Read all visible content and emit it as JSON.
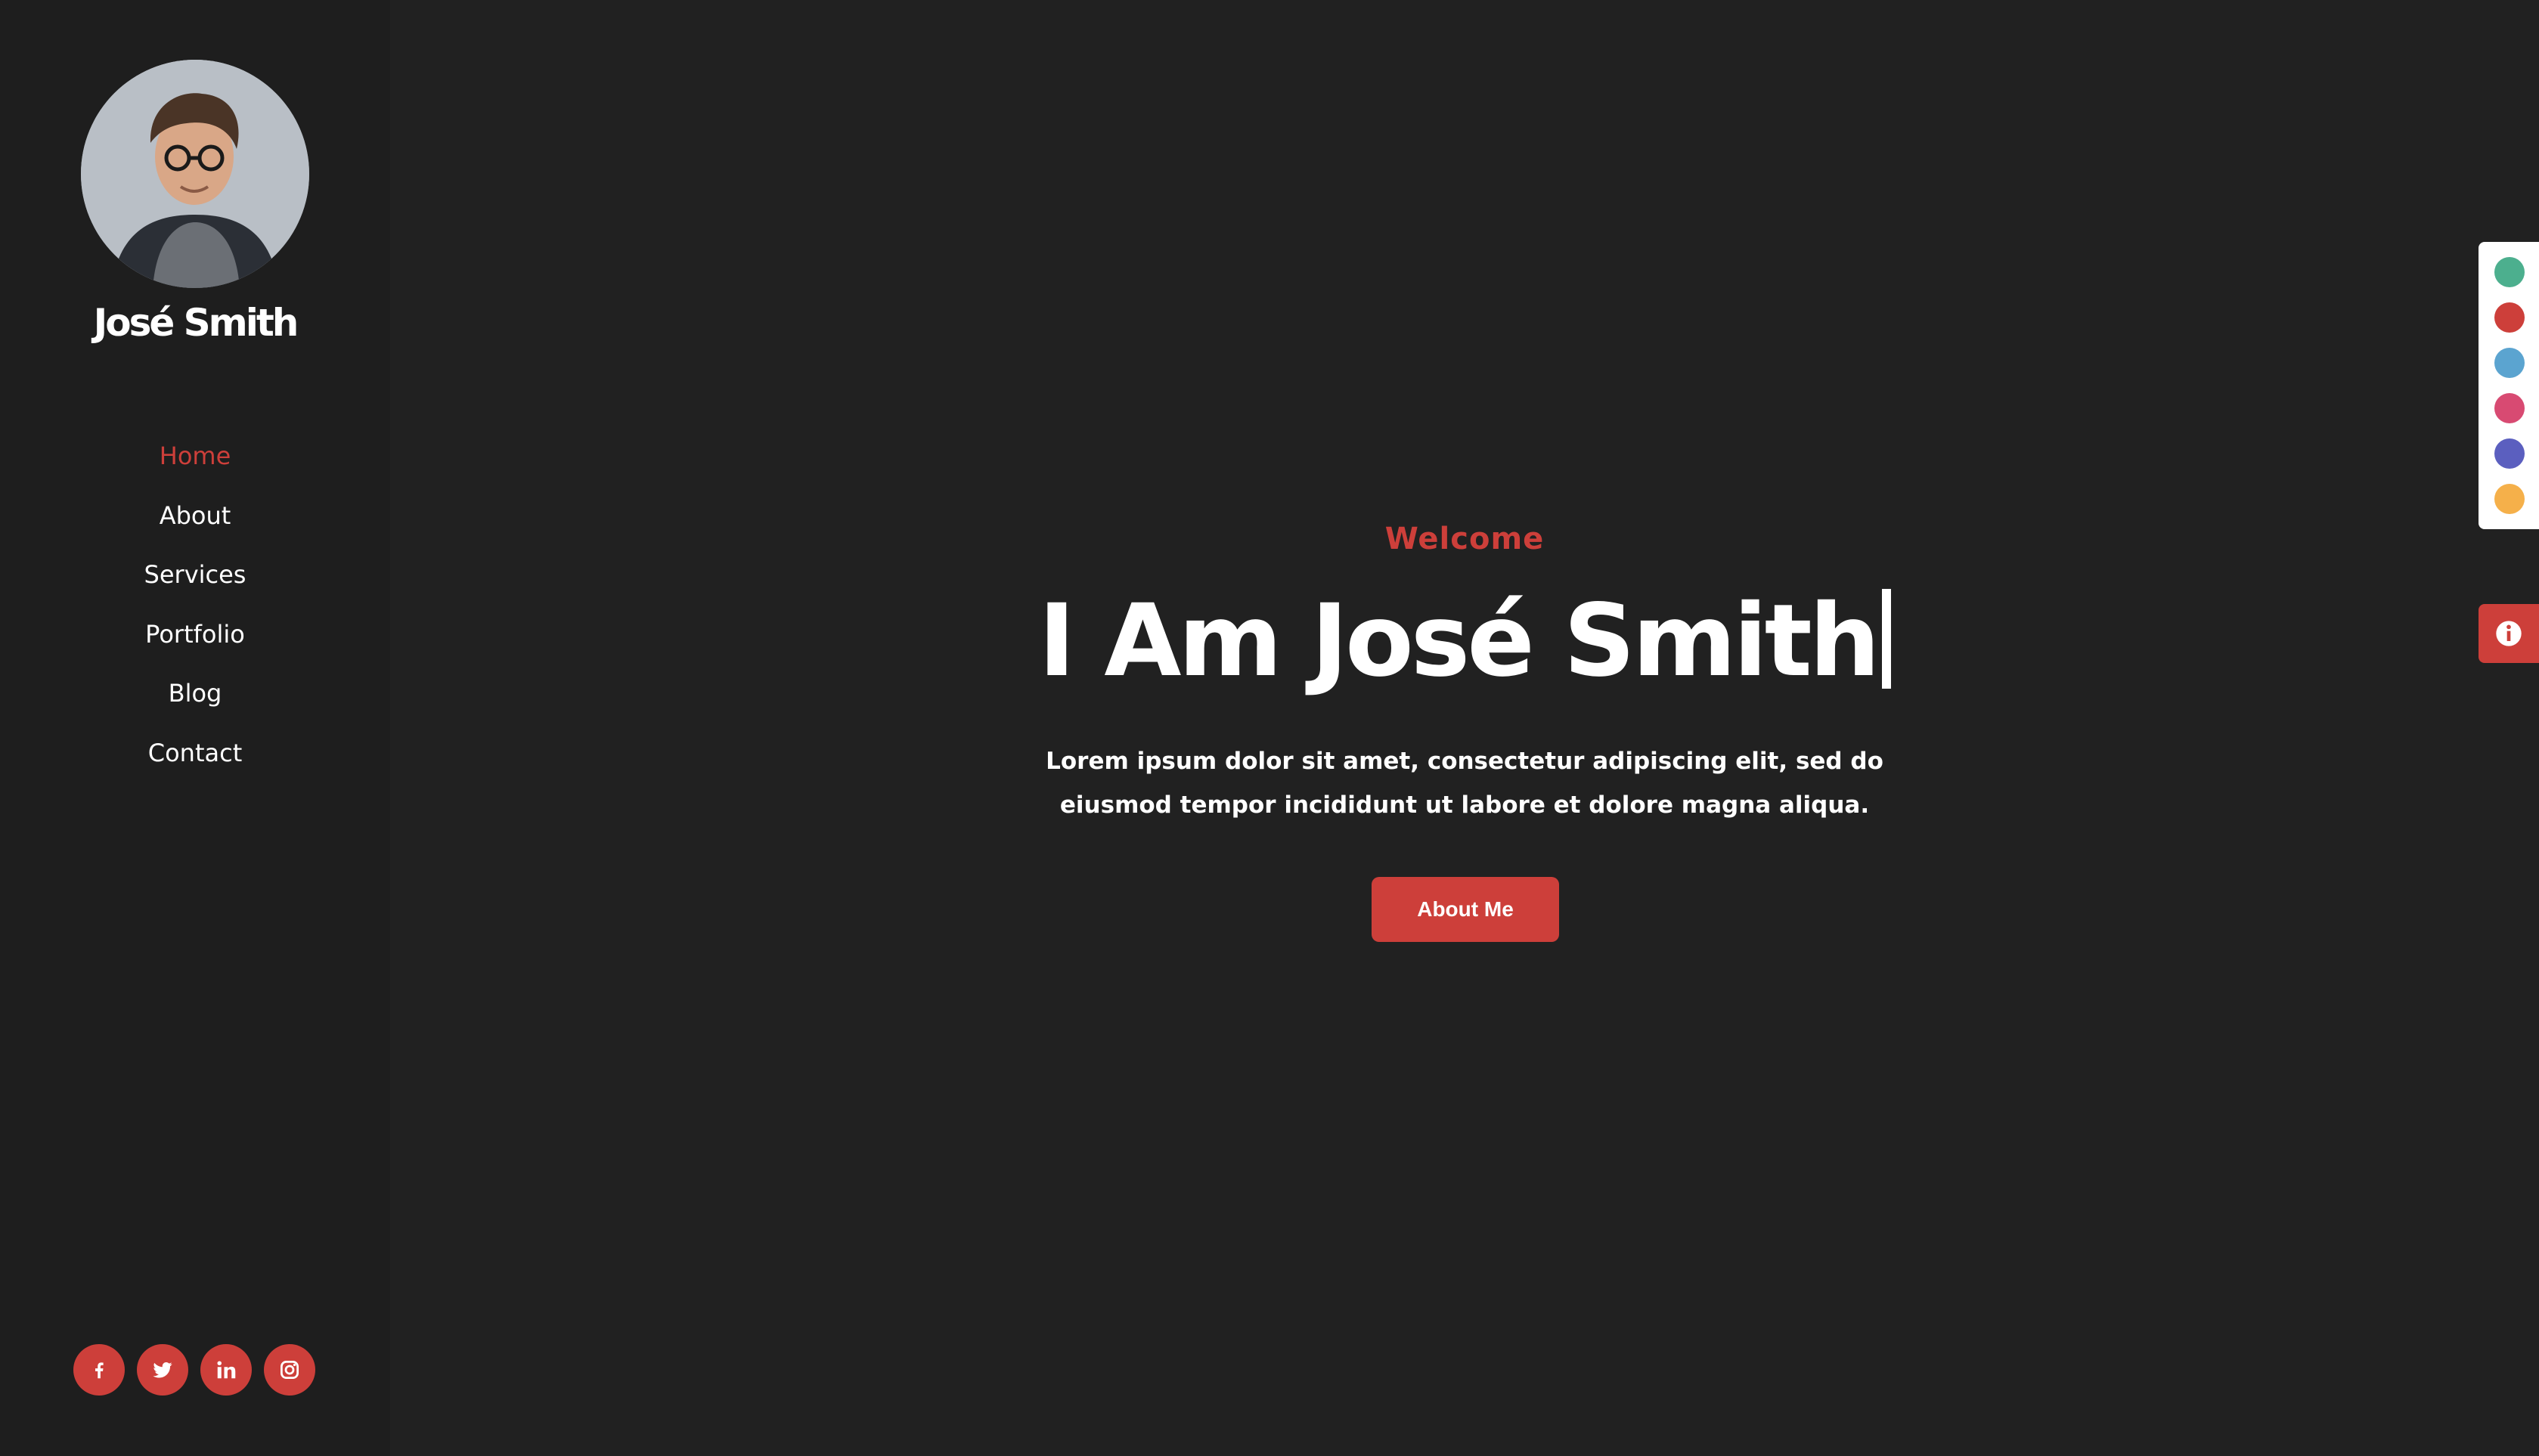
{
  "profile": {
    "name": "José Smith",
    "avatar_icon": "portrait-photo"
  },
  "nav": {
    "items": [
      {
        "label": "Home",
        "active": true
      },
      {
        "label": "About",
        "active": false
      },
      {
        "label": "Services",
        "active": false
      },
      {
        "label": "Portfolio",
        "active": false
      },
      {
        "label": "Blog",
        "active": false
      },
      {
        "label": "Contact",
        "active": false
      }
    ]
  },
  "socials": [
    {
      "icon": "facebook-icon"
    },
    {
      "icon": "twitter-icon"
    },
    {
      "icon": "linkedin-icon"
    },
    {
      "icon": "instagram-icon"
    }
  ],
  "hero": {
    "welcome": "Welcome",
    "headline": "I Am José Smith",
    "lead": "Lorem ipsum dolor sit amet, consectetur adipiscing elit, sed do eiusmod tempor incididunt ut labore et dolore magna aliqua.",
    "button_label": "About Me"
  },
  "color_switcher": {
    "swatches": [
      "#4caf8e",
      "#cd3f3a",
      "#5ba4d0",
      "#d84a72",
      "#5b5fbf",
      "#f5b04a"
    ]
  },
  "info_button": {
    "icon": "info-icon"
  },
  "colors": {
    "accent": "#cd3f3a",
    "background": "#212121",
    "sidebar": "#1e1e1e",
    "text": "#ffffff"
  }
}
